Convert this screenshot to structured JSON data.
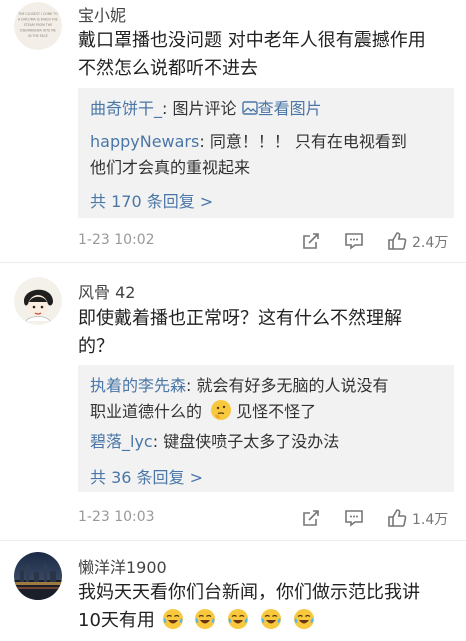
{
  "comments": [
    {
      "username": "宝小妮",
      "avatar_text": [
        "THE CLOSEST I COME TO",
        "A DIPLOMA IS WHEN THE",
        "STEAM FROM THE",
        "DISHWASHER HITS ME",
        "IN THE FACE"
      ],
      "text_lines": [
        "戴口罩播也没问题 对中老年人很有震撼作用",
        "不然怎么说都听不进去"
      ],
      "replies": [
        {
          "name": "曲奇饼干_",
          "sep": ": ",
          "text": "图片评论 ",
          "link_icon": "image-icon",
          "link_text": "查看图片"
        },
        {
          "name": "happyNewars",
          "sep": ": ",
          "text": "同意！！！ 只有在电视看到",
          "cont": "他们才会真的重视起来"
        }
      ],
      "more_label": "共 170 条回复 >",
      "date": "1-23 10:02",
      "likes": "2.4万"
    },
    {
      "username": "风骨 42",
      "text_lines": [
        "即使戴着播也正常呀？这有什么不然理解",
        "的？"
      ],
      "replies": [
        {
          "name": "执着的李先森",
          "sep": ": ",
          "text": "就会有好多无脑的人说没有",
          "cont": "职业道德什么的",
          "cont_emoji": "thinking-emoji",
          "cont_after": "见怪不怪了"
        },
        {
          "name": "碧落_lyc",
          "sep": ": ",
          "text": "键盘侠喷子太多了没办法"
        }
      ],
      "more_label": "共 36 条回复 >",
      "date": "1-23 10:03",
      "likes": "1.4万"
    },
    {
      "username": "懒洋洋1900",
      "text_lines": [
        "我妈天天看你们台新闻，你们做示范比我讲",
        "10天有用"
      ],
      "trailing_emoji": "crying-laughing-emoji",
      "trailing_emoji_count": 5
    }
  ],
  "colors": {
    "link": "#4a76a8",
    "reply_bg": "#f2f2f2",
    "meta": "#999999"
  }
}
